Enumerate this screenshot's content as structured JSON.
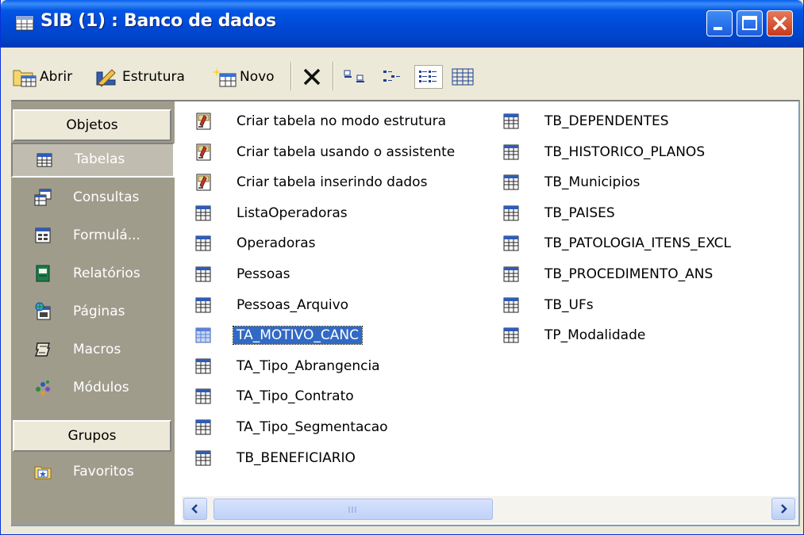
{
  "window": {
    "title": "SIB (1) : Banco de dados"
  },
  "toolbar": {
    "open": "Abrir",
    "design": "Estrutura",
    "new": "Novo"
  },
  "sidebar": {
    "objects_header": "Objetos",
    "items": [
      {
        "label": "Tabelas",
        "icon": "table-icon"
      },
      {
        "label": "Consultas",
        "icon": "query-icon"
      },
      {
        "label": "Formulá...",
        "icon": "form-icon"
      },
      {
        "label": "Relatórios",
        "icon": "report-icon"
      },
      {
        "label": "Páginas",
        "icon": "page-icon"
      },
      {
        "label": "Macros",
        "icon": "macro-icon"
      },
      {
        "label": "Módulos",
        "icon": "module-icon"
      }
    ],
    "groups_header": "Grupos",
    "groups": [
      {
        "label": "Favoritos",
        "icon": "favorites-icon"
      }
    ]
  },
  "list": {
    "selected": "TA_MOTIVO_CANC",
    "column1": [
      {
        "label": "Criar tabela no modo estrutura",
        "icon": "wizard-icon"
      },
      {
        "label": "Criar tabela usando o assistente",
        "icon": "wizard-icon"
      },
      {
        "label": "Criar tabela inserindo dados",
        "icon": "wizard-icon"
      },
      {
        "label": "ListaOperadoras",
        "icon": "table-icon"
      },
      {
        "label": "Operadoras",
        "icon": "table-icon"
      },
      {
        "label": "Pessoas",
        "icon": "table-icon"
      },
      {
        "label": "Pessoas_Arquivo",
        "icon": "table-icon"
      },
      {
        "label": "TA_MOTIVO_CANC",
        "icon": "table-icon"
      },
      {
        "label": "TA_Tipo_Abrangencia",
        "icon": "table-icon"
      },
      {
        "label": "TA_Tipo_Contrato",
        "icon": "table-icon"
      },
      {
        "label": "TA_Tipo_Segmentacao",
        "icon": "table-icon"
      },
      {
        "label": "TB_BENEFICIARIO",
        "icon": "table-icon"
      }
    ],
    "column2": [
      {
        "label": "TB_DEPENDENTES",
        "icon": "table-icon"
      },
      {
        "label": "TB_HISTORICO_PLANOS",
        "icon": "table-icon"
      },
      {
        "label": "TB_Municipios",
        "icon": "table-icon"
      },
      {
        "label": "TB_PAISES",
        "icon": "table-icon"
      },
      {
        "label": "TB_PATOLOGIA_ITENS_EXCL",
        "icon": "table-icon"
      },
      {
        "label": "TB_PROCEDIMENTO_ANS",
        "icon": "table-icon"
      },
      {
        "label": "TB_UFs",
        "icon": "table-icon"
      },
      {
        "label": "TP_Modalidade",
        "icon": "table-icon"
      }
    ]
  }
}
